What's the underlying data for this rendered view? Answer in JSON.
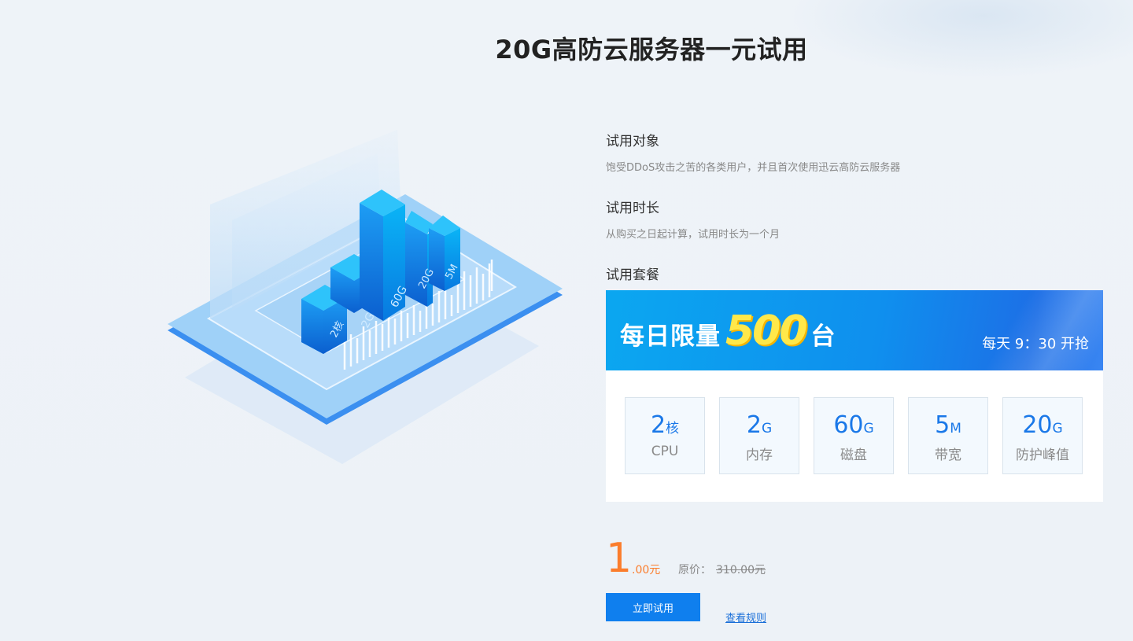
{
  "page": {
    "title": "20G高防云服务器一元试用"
  },
  "illustration": {
    "bar_labels": [
      "2核",
      "2G",
      "60G",
      "20G",
      "5M"
    ]
  },
  "sections": [
    {
      "title": "试用对象",
      "desc": "饱受DDoS攻击之苦的各类用户，并且首次使用迅云高防云服务器"
    },
    {
      "title": "试用时长",
      "desc": "从购买之日起计算，试用时长为一个月"
    },
    {
      "title": "试用套餐"
    }
  ],
  "banner": {
    "prefix": "每日限量",
    "number": "500",
    "suffix": "台",
    "time": "每天 9：30 开抢"
  },
  "specs": [
    {
      "value": "2",
      "unit": "核",
      "label": "CPU"
    },
    {
      "value": "2",
      "unit": "G",
      "label": "内存"
    },
    {
      "value": "60",
      "unit": "G",
      "label": "磁盘"
    },
    {
      "value": "5",
      "unit": "M",
      "label": "带宽"
    },
    {
      "value": "20",
      "unit": "G",
      "label": "防护峰值"
    }
  ],
  "price": {
    "integer": "1",
    "decimal": ".00元",
    "original_label": "原价：",
    "original_value": "310.00元"
  },
  "actions": {
    "try_label": "立即试用",
    "rules_label": "查看规则"
  },
  "colors": {
    "accent": "#0f7fee",
    "price": "#fb7d2c",
    "spec_value": "#1a78e8",
    "banner_highlight": "#ffe84a"
  }
}
